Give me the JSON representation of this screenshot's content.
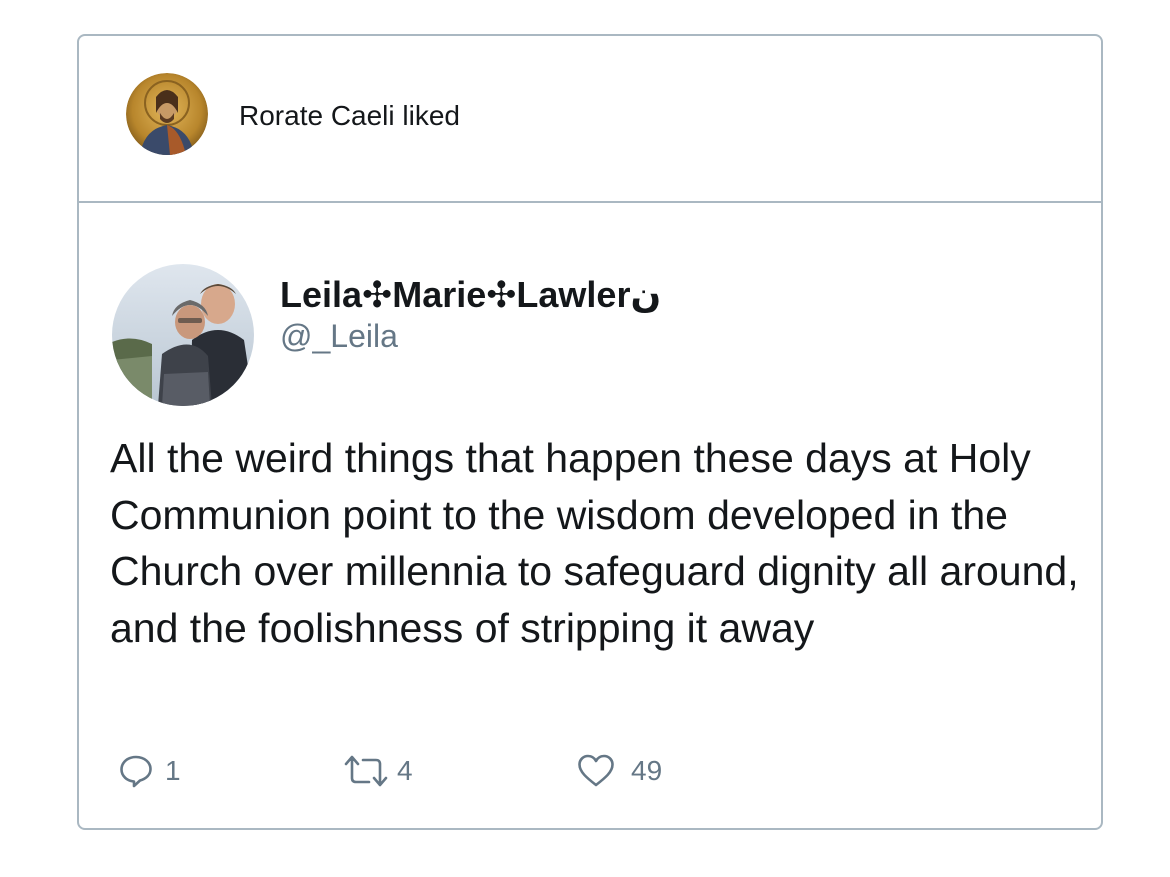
{
  "liked_header": {
    "text": "Rorate Caeli liked",
    "avatar_icon": "christ-icon-avatar"
  },
  "tweet": {
    "author_name": "Leila✣Marie✣Lawlerن",
    "author_handle": "@_Leila",
    "text": "All the weird things that happen these days at Holy Communion point to the wisdom developed in the Church over millennia to safeguard dignity all around, and the foolishness of stripping it away",
    "actions": {
      "replies": "1",
      "retweets": "4",
      "likes": "49"
    }
  },
  "colors": {
    "border": "#aab8c2",
    "text": "#14171a",
    "secondary": "#657786"
  }
}
